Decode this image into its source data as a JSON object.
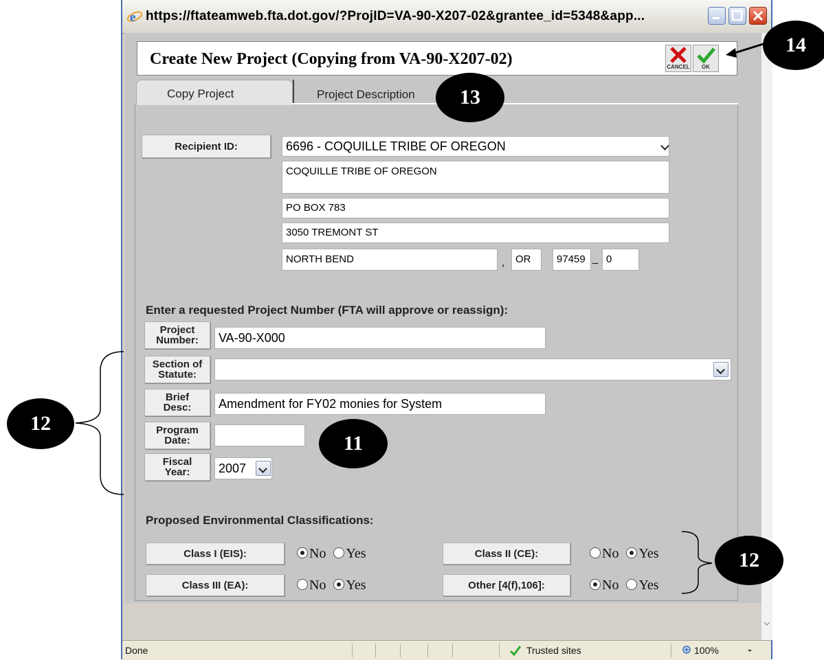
{
  "window": {
    "url": "https://ftateamweb.fta.dot.gov/?ProjID=VA-90-X207-02&grantee_id=5348&app..."
  },
  "header": {
    "title": "Create New Project (Copying from VA-90-X207-02)",
    "cancel_label": "CANCEL",
    "ok_label": "OK"
  },
  "tabs": [
    {
      "label": "Copy Project"
    },
    {
      "label": "Project Description"
    }
  ],
  "recipient": {
    "label": "Recipient ID:",
    "selected": "6696 - COQUILLE TRIBE OF OREGON",
    "name": "COQUILLE TRIBE OF OREGON",
    "address1": "PO BOX 783",
    "address2": "3050 TREMONT ST",
    "city": "NORTH BEND",
    "comma": ",",
    "state": "OR",
    "zip": "97459",
    "dash": "_",
    "zip4": "0"
  },
  "project": {
    "heading": "Enter a requested Project Number (FTA will approve or reassign):",
    "number_label_1": "Project",
    "number_label_2": "Number:",
    "number_value": "VA-90-X000",
    "statute_label_1": "Section of",
    "statute_label_2": "Statute:",
    "statute_value": "",
    "brief_label_1": "Brief",
    "brief_label_2": "Desc:",
    "brief_value": "Amendment for FY02 monies for System",
    "program_label_1": "Program",
    "program_label_2": "Date:",
    "program_value": "",
    "fiscal_label_1": "Fiscal",
    "fiscal_label_2": "Year:",
    "fiscal_value": "2007"
  },
  "environment": {
    "heading": "Proposed Environmental Classifications:",
    "no_label": "No",
    "yes_label": "Yes",
    "classes": [
      {
        "label": "Class I (EIS):",
        "value": "No"
      },
      {
        "label": "Class II (CE):",
        "value": "Yes"
      },
      {
        "label": "Class III (EA):",
        "value": "Yes"
      },
      {
        "label": "Other [4(f),106]:",
        "value": "No"
      }
    ]
  },
  "callouts": {
    "c11": "11",
    "c12a": "12",
    "c12b": "12",
    "c13": "13",
    "c14": "14"
  },
  "statusbar": {
    "status": "Done",
    "zone": "Trusted sites",
    "zoom": "100%"
  },
  "colors": {
    "window_border": "#4a6fb0",
    "panel_bg": "#c6c6c6",
    "callout": "#000000",
    "ok_green": "#2fa82f",
    "cancel_red": "#d01010"
  }
}
